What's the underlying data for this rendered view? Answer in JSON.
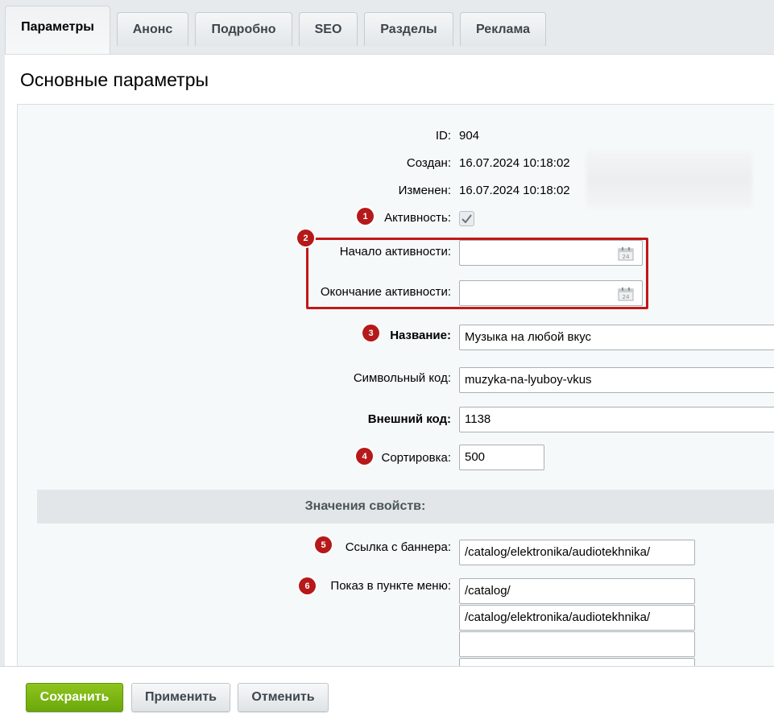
{
  "tabs": [
    {
      "label": "Параметры",
      "active": true
    },
    {
      "label": "Анонс",
      "active": false
    },
    {
      "label": "Подробно",
      "active": false
    },
    {
      "label": "SEO",
      "active": false
    },
    {
      "label": "Разделы",
      "active": false
    },
    {
      "label": "Реклама",
      "active": false
    }
  ],
  "section_title": "Основные параметры",
  "info": {
    "id_label": "ID:",
    "id_value": "904",
    "created_label": "Создан:",
    "created_value": "16.07.2024 10:18:02",
    "modified_label": "Изменен:",
    "modified_value": "16.07.2024 10:18:02"
  },
  "badges": [
    "1",
    "2",
    "3",
    "4",
    "5",
    "6"
  ],
  "fields": {
    "active_label": "Активность:",
    "active_checked": true,
    "active_from_label": "Начало активности:",
    "active_from_value": "",
    "active_to_label": "Окончание активности:",
    "active_to_value": "",
    "name_label": "Название:",
    "name_value": "Музыка на любой вкус",
    "code_label": "Символьный код:",
    "code_value": "muzyka-na-lyuboy-vkus",
    "xml_id_label": "Внешний код:",
    "xml_id_value": "1138",
    "sort_label": "Сортировка:",
    "sort_value": "500"
  },
  "properties": {
    "header": "Значения свойств:",
    "banner_link_label": "Ссылка с баннера:",
    "banner_link_value": "/catalog/elektronika/audiotekhnika/",
    "menu_label": "Показ в пункте меню:",
    "menu_values": [
      "/catalog/",
      "/catalog/elektronika/audiotekhnika/",
      "",
      ""
    ]
  },
  "buttons": {
    "save": "Сохранить",
    "apply": "Применить",
    "cancel": "Отменить"
  },
  "colors": {
    "accent_green": "#7ab614",
    "badge_red": "#b5191a",
    "highlight_red": "#c21717"
  }
}
